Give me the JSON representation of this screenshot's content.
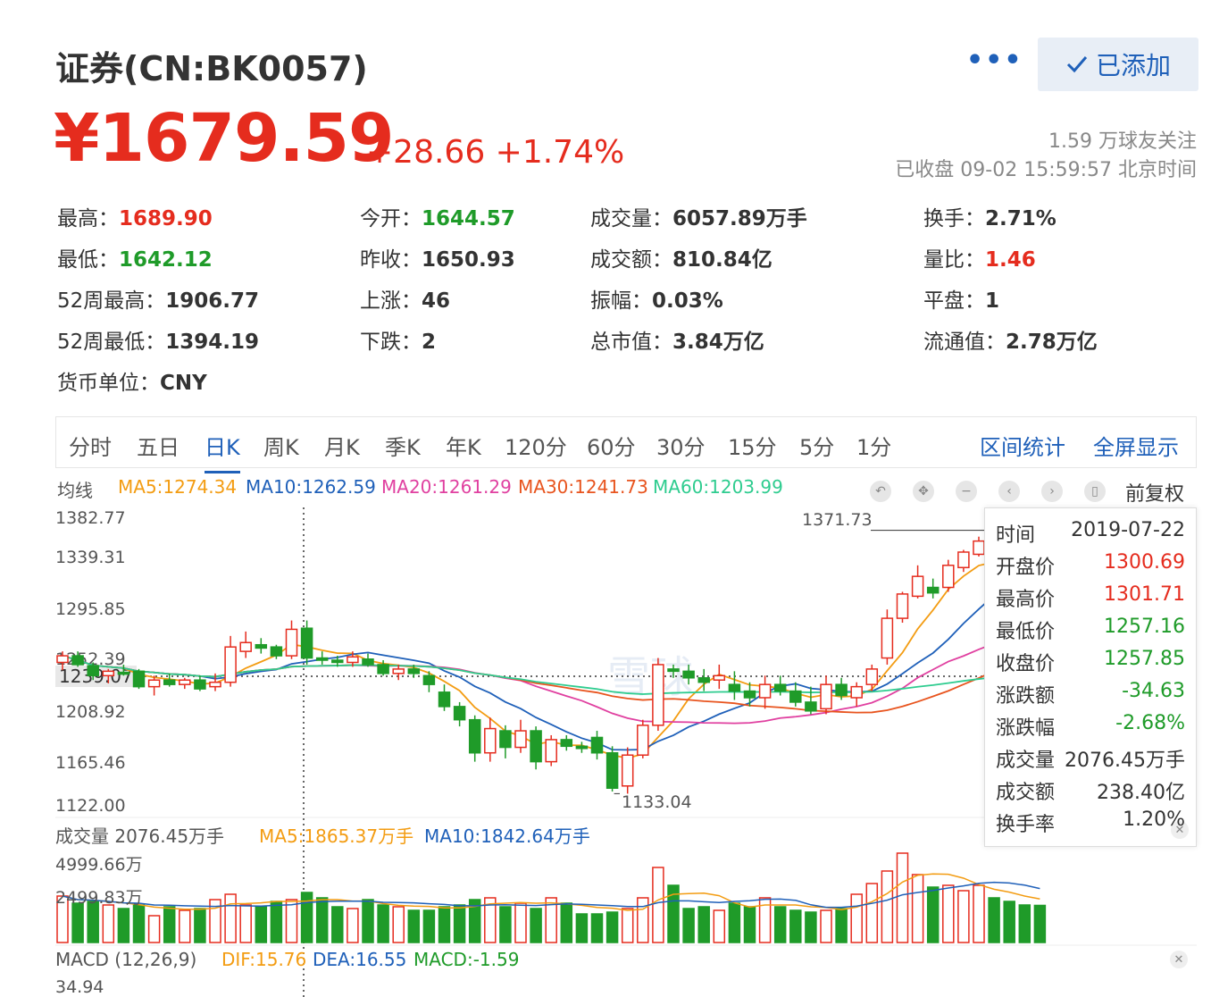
{
  "header": {
    "title": "证券(CN:BK0057)",
    "more_label": "•••",
    "added_label": "已添加",
    "price": "¥1679.59",
    "change": "+28.66 +1.74%",
    "followers": "1.59 万球友关注",
    "status": "已收盘 09-02 15:59:57 北京时间"
  },
  "stats": [
    {
      "label": "最高：",
      "value": "1689.90",
      "color": "#e52c1e"
    },
    {
      "label": "今开：",
      "value": "1644.57",
      "color": "#1f9b29"
    },
    {
      "label": "成交量：",
      "value": "6057.89万手",
      "color": "#333333"
    },
    {
      "label": "换手：",
      "value": "2.71%",
      "color": "#333333"
    },
    {
      "label": "最低：",
      "value": "1642.12",
      "color": "#1f9b29"
    },
    {
      "label": "昨收：",
      "value": "1650.93",
      "color": "#333333"
    },
    {
      "label": "成交额：",
      "value": "810.84亿",
      "color": "#333333"
    },
    {
      "label": "量比：",
      "value": "1.46",
      "color": "#e52c1e"
    },
    {
      "label": "52周最高：",
      "value": "1906.77",
      "color": "#333333"
    },
    {
      "label": "上涨：",
      "value": "46",
      "color": "#333333"
    },
    {
      "label": "振幅：",
      "value": "0.03%",
      "color": "#333333"
    },
    {
      "label": "平盘：",
      "value": "1",
      "color": "#333333"
    },
    {
      "label": "52周最低：",
      "value": "1394.19",
      "color": "#333333"
    },
    {
      "label": "下跌：",
      "value": "2",
      "color": "#333333"
    },
    {
      "label": "总市值：",
      "value": "3.84万亿",
      "color": "#333333"
    },
    {
      "label": "流通值：",
      "value": "2.78万亿",
      "color": "#333333"
    },
    {
      "label": "货币单位：",
      "value": "CNY",
      "color": "#333333"
    }
  ],
  "tabs": [
    "分时",
    "五日",
    "日K",
    "周K",
    "月K",
    "季K",
    "年K",
    "120分",
    "60分",
    "30分",
    "15分",
    "5分",
    "1分"
  ],
  "active_tab": "日K",
  "tab_actions": [
    "区间统计",
    "全屏显示"
  ],
  "ma_legend": {
    "label": "均线",
    "items": [
      {
        "text": "MA5:1274.34",
        "color": "#f39c12"
      },
      {
        "text": "MA10:1262.59",
        "color": "#1f60b9"
      },
      {
        "text": "MA20:1261.29",
        "color": "#e040a0"
      },
      {
        "text": "MA30:1241.73",
        "color": "#e8541e"
      },
      {
        "text": "MA60:1203.99",
        "color": "#2ecc8f"
      }
    ]
  },
  "adjust_label": "前复权",
  "toolbar_icons": [
    "undo-icon",
    "move-icon",
    "minus-icon",
    "prev-icon",
    "next-icon",
    "lock-icon"
  ],
  "price_axis": [
    "1382.77",
    "1339.31",
    "1295.85",
    "1252.39",
    "1208.92",
    "1165.46",
    "1122.00"
  ],
  "crosshair_price": "1239.07",
  "high_marker": "1371.73",
  "low_marker": "1133.04",
  "watermark": "雪球",
  "tooltip": [
    {
      "label": "时间",
      "value": "2019-07-22",
      "color": "#333333"
    },
    {
      "label": "开盘价",
      "value": "1300.69",
      "color": "#e52c1e"
    },
    {
      "label": "最高价",
      "value": "1301.71",
      "color": "#e52c1e"
    },
    {
      "label": "最低价",
      "value": "1257.16",
      "color": "#1f9b29"
    },
    {
      "label": "收盘价",
      "value": "1257.85",
      "color": "#1f9b29"
    },
    {
      "label": "涨跌额",
      "value": "-34.63",
      "color": "#1f9b29"
    },
    {
      "label": "涨跌幅",
      "value": "-2.68%",
      "color": "#1f9b29"
    },
    {
      "label": "成交量",
      "value": "2076.45万手",
      "color": "#333333"
    },
    {
      "label": "成交额",
      "value": "238.40亿",
      "color": "#333333"
    },
    {
      "label": "换手率",
      "value": "1.20%",
      "color": "#333333"
    }
  ],
  "volume": {
    "label": "成交量 2076.45万手",
    "ma5": "MA5:1865.37万手",
    "ma10": "MA10:1842.64万手",
    "axis_top": "4999.66万",
    "axis_mid": "2499.83万"
  },
  "macd": {
    "label": "MACD (12,26,9)",
    "dif": "DIF:15.76",
    "dea": "DEA:16.55",
    "macd": "MACD:-1.59",
    "axis_top": "34.94"
  },
  "colors": {
    "up": "#e52c1e",
    "down": "#1f9b29",
    "accent": "#1f60b9"
  },
  "chart_data": {
    "type": "candlestick",
    "ylim": [
      1122.0,
      1382.77
    ],
    "candles": [
      [
        1252,
        1262,
        1245,
        1258
      ],
      [
        1258,
        1262,
        1248,
        1250
      ],
      [
        1249,
        1252,
        1236,
        1240
      ],
      [
        1240,
        1246,
        1233,
        1244
      ],
      [
        1243,
        1250,
        1240,
        1242
      ],
      [
        1244,
        1246,
        1228,
        1230
      ],
      [
        1230,
        1240,
        1222,
        1236
      ],
      [
        1236,
        1242,
        1230,
        1232
      ],
      [
        1232,
        1238,
        1228,
        1236
      ],
      [
        1236,
        1240,
        1226,
        1228
      ],
      [
        1230,
        1242,
        1226,
        1234
      ],
      [
        1234,
        1276,
        1230,
        1266
      ],
      [
        1262,
        1280,
        1256,
        1270
      ],
      [
        1268,
        1274,
        1260,
        1265
      ],
      [
        1266,
        1268,
        1255,
        1258
      ],
      [
        1258,
        1290,
        1255,
        1282
      ],
      [
        1283,
        1290,
        1250,
        1256
      ],
      [
        1256,
        1262,
        1250,
        1254
      ],
      [
        1254,
        1258,
        1248,
        1252
      ],
      [
        1252,
        1262,
        1248,
        1257
      ],
      [
        1255,
        1260,
        1248,
        1250
      ],
      [
        1250,
        1254,
        1240,
        1242
      ],
      [
        1242,
        1250,
        1236,
        1246
      ],
      [
        1246,
        1250,
        1238,
        1242
      ],
      [
        1240,
        1244,
        1225,
        1232
      ],
      [
        1225,
        1232,
        1208,
        1212
      ],
      [
        1212,
        1216,
        1194,
        1200
      ],
      [
        1200,
        1204,
        1162,
        1170
      ],
      [
        1170,
        1202,
        1162,
        1192
      ],
      [
        1190,
        1195,
        1165,
        1175
      ],
      [
        1175,
        1200,
        1170,
        1190
      ],
      [
        1190,
        1194,
        1155,
        1162
      ],
      [
        1162,
        1186,
        1158,
        1182
      ],
      [
        1182,
        1186,
        1172,
        1176
      ],
      [
        1176,
        1180,
        1170,
        1174
      ],
      [
        1184,
        1190,
        1164,
        1170
      ],
      [
        1170,
        1176,
        1135,
        1138
      ],
      [
        1140,
        1175,
        1133,
        1168
      ],
      [
        1168,
        1200,
        1165,
        1195
      ],
      [
        1195,
        1256,
        1190,
        1250
      ],
      [
        1246,
        1250,
        1238,
        1244
      ],
      [
        1244,
        1250,
        1232,
        1238
      ],
      [
        1238,
        1246,
        1226,
        1234
      ],
      [
        1236,
        1250,
        1228,
        1240
      ],
      [
        1232,
        1244,
        1218,
        1226
      ],
      [
        1226,
        1234,
        1212,
        1220
      ],
      [
        1220,
        1240,
        1210,
        1232
      ],
      [
        1232,
        1240,
        1222,
        1226
      ],
      [
        1226,
        1234,
        1212,
        1216
      ],
      [
        1216,
        1230,
        1205,
        1208
      ],
      [
        1210,
        1240,
        1205,
        1232
      ],
      [
        1232,
        1238,
        1218,
        1222
      ],
      [
        1220,
        1234,
        1212,
        1230
      ],
      [
        1232,
        1250,
        1226,
        1246
      ],
      [
        1256,
        1300,
        1250,
        1292
      ],
      [
        1292,
        1316,
        1288,
        1314
      ],
      [
        1312,
        1340,
        1310,
        1330
      ],
      [
        1320,
        1328,
        1310,
        1315
      ],
      [
        1320,
        1345,
        1316,
        1340
      ],
      [
        1338,
        1354,
        1334,
        1352
      ],
      [
        1350,
        1366,
        1348,
        1362
      ],
      [
        1366,
        1371.73,
        1340,
        1346
      ],
      [
        1340,
        1346,
        1310,
        1318
      ],
      [
        1318,
        1326,
        1305,
        1309
      ],
      [
        1300.69,
        1301.71,
        1257.16,
        1257.85
      ]
    ],
    "volume_max": 4999.66,
    "volume": [
      2600,
      2200,
      2300,
      2100,
      1900,
      2100,
      1500,
      2000,
      1800,
      1900,
      2400,
      2700,
      2100,
      2000,
      2300,
      2400,
      2800,
      2500,
      2000,
      1900,
      2400,
      2100,
      2000,
      1800,
      1800,
      2000,
      2100,
      2400,
      2500,
      2000,
      2200,
      1900,
      2500,
      2200,
      1600,
      1600,
      1700,
      1900,
      2500,
      4200,
      3200,
      1900,
      2000,
      1800,
      2200,
      2000,
      2500,
      2000,
      1800,
      1700,
      1800,
      1900,
      2700,
      3300,
      4000,
      5000,
      3800,
      3100,
      3200,
      2900,
      3200,
      2500,
      2300,
      2100,
      2076.45
    ]
  }
}
